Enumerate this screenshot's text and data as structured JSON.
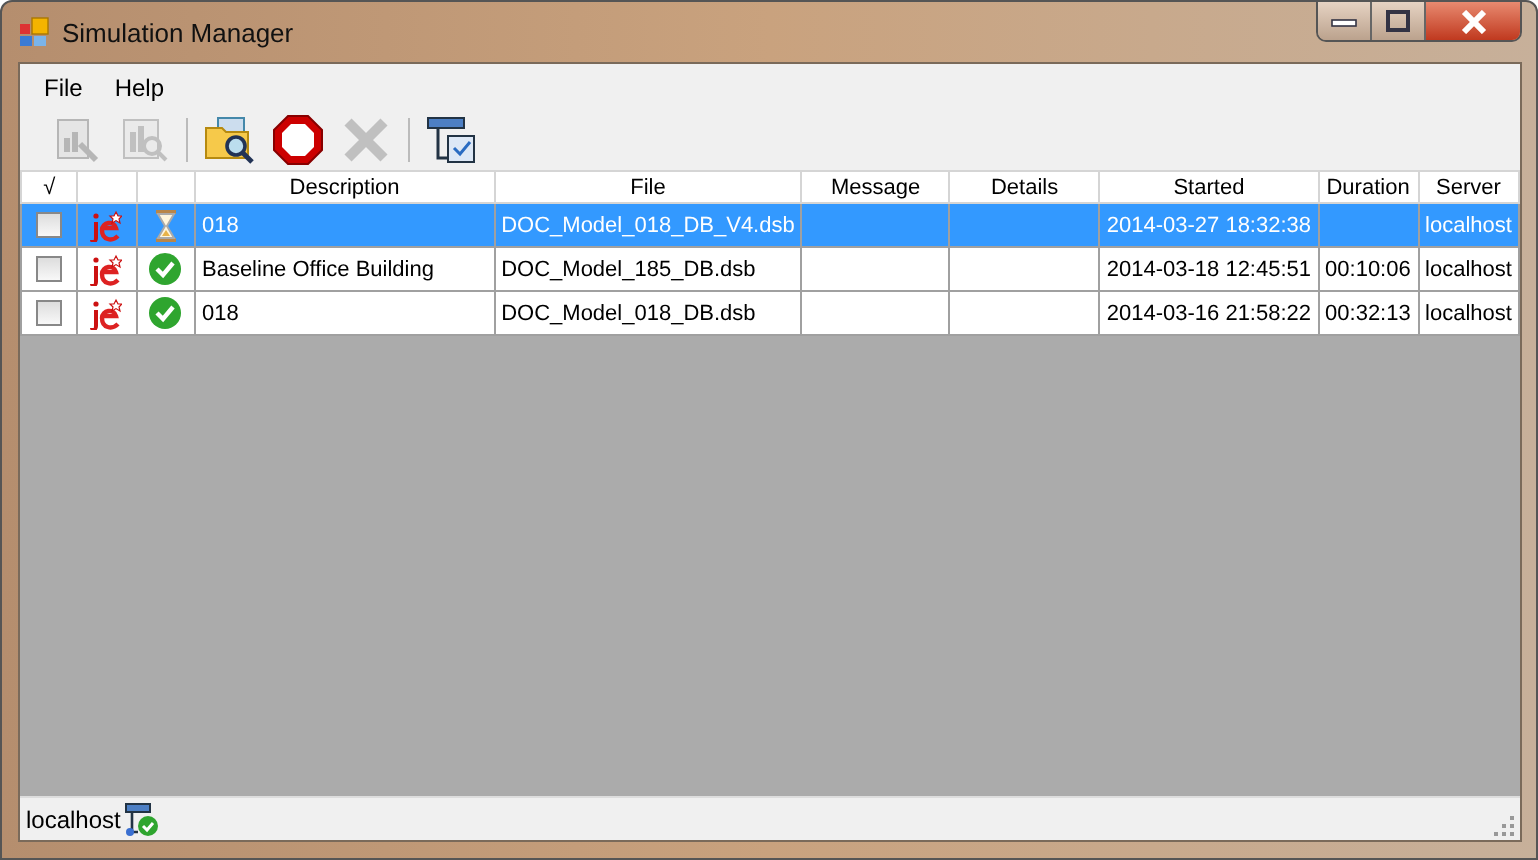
{
  "window": {
    "title": "Simulation Manager"
  },
  "menu": [
    "File",
    "Help"
  ],
  "toolbar": [
    {
      "kind": "report",
      "disabled": true
    },
    {
      "kind": "inspect",
      "disabled": true
    },
    {
      "kind": "open",
      "disabled": false
    },
    {
      "kind": "stop",
      "disabled": false
    },
    {
      "kind": "delete",
      "disabled": true
    },
    {
      "kind": "server",
      "disabled": false
    }
  ],
  "table": {
    "columns": [
      "√",
      "Description",
      "File",
      "Message",
      "Details",
      "Started",
      "Duration",
      "Server"
    ],
    "rows": [
      {
        "selected": true,
        "checked": false,
        "finished": false,
        "description": "018",
        "file": "DOC_Model_018_DB_V4.dsb",
        "started": "2014-03-27 18:32:38",
        "server": "localhost"
      },
      {
        "selected": false,
        "checked": false,
        "finished": true,
        "description": "Baseline Office Building",
        "file": "DOC_Model_185_DB.dsb",
        "started": "2014-03-18 12:45:51",
        "duration": "00:10:06",
        "server": "localhost"
      },
      {
        "selected": false,
        "checked": false,
        "finished": true,
        "description": "018",
        "file": "DOC_Model_018_DB.dsb",
        "started": "2014-03-16 21:58:22",
        "duration": "00:32:13",
        "server": "localhost"
      }
    ]
  },
  "status_bar": {
    "server": "localhost"
  }
}
